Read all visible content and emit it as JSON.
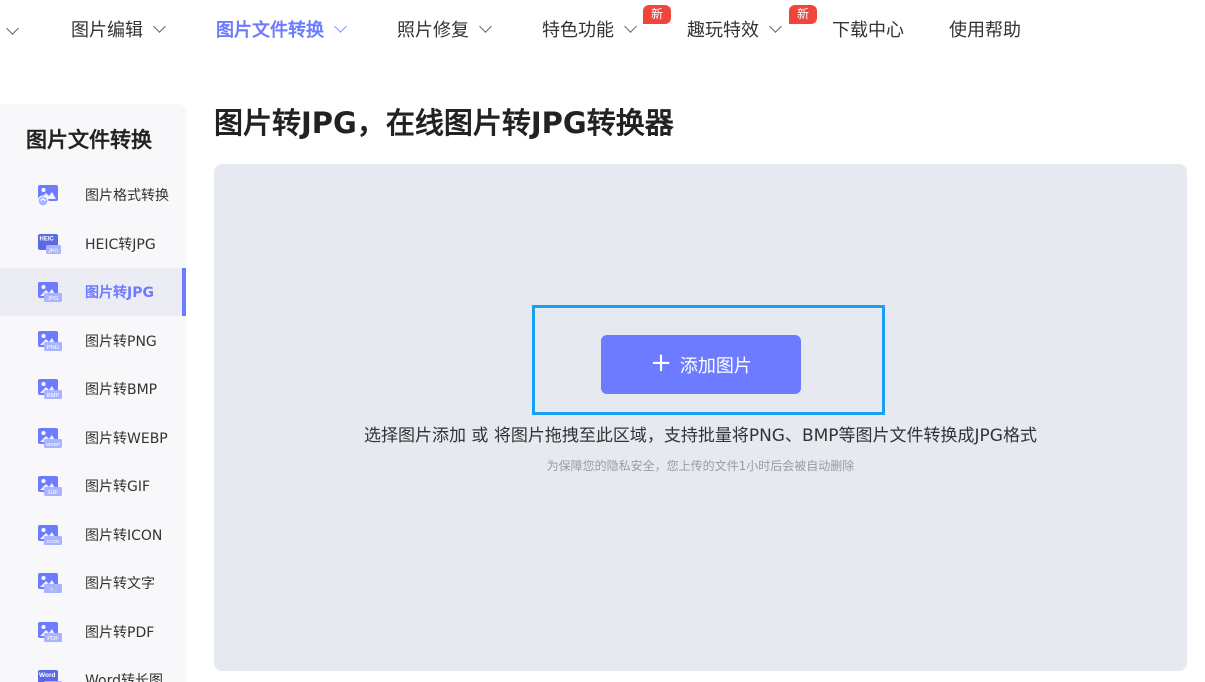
{
  "topnav": {
    "items": [
      {
        "label": "图片编辑"
      },
      {
        "label": "图片文件转换"
      },
      {
        "label": "照片修复"
      },
      {
        "label": "特色功能",
        "badge": "新"
      },
      {
        "label": "趣玩特效",
        "badge": "新"
      },
      {
        "label": "下载中心"
      },
      {
        "label": "使用帮助"
      }
    ],
    "active_index": 1
  },
  "sidebar": {
    "title": "图片文件转换",
    "items": [
      {
        "label": "图片格式转换",
        "icon": "image-convert-icon",
        "tag": ""
      },
      {
        "label": "HEIC转JPG",
        "icon": "heic-jpg-icon",
        "tag": "HEIC JPG"
      },
      {
        "label": "图片转JPG",
        "icon": "image-jpg-icon",
        "tag": "JPG"
      },
      {
        "label": "图片转PNG",
        "icon": "image-png-icon",
        "tag": "PNG"
      },
      {
        "label": "图片转BMP",
        "icon": "image-bmp-icon",
        "tag": "BMP"
      },
      {
        "label": "图片转WEBP",
        "icon": "image-webp-icon",
        "tag": "WEBP"
      },
      {
        "label": "图片转GIF",
        "icon": "image-gif-icon",
        "tag": "GIF"
      },
      {
        "label": "图片转ICON",
        "icon": "image-icon-icon",
        "tag": "ICON"
      },
      {
        "label": "图片转文字",
        "icon": "image-text-icon",
        "tag": "T..."
      },
      {
        "label": "图片转PDF",
        "icon": "image-pdf-icon",
        "tag": "PDF"
      },
      {
        "label": "Word转长图",
        "icon": "word-image-icon",
        "tag": "Word"
      }
    ],
    "active_index": 2
  },
  "main": {
    "title": "图片转JPG，在线图片转JPG转换器",
    "add_button": {
      "plus": "+",
      "label": "添加图片"
    },
    "hint": "选择图片添加 或 将图片拖拽至此区域，支持批量将PNG、BMP等图片文件转换成JPG格式",
    "privacy_note": "为保障您的隐私安全，您上传的文件1小时后会被自动删除"
  },
  "colors": {
    "accent": "#6c7bff",
    "badge": "#f0453a",
    "frame": "#1aa0f3",
    "drop_bg": "#e7e9f1"
  }
}
